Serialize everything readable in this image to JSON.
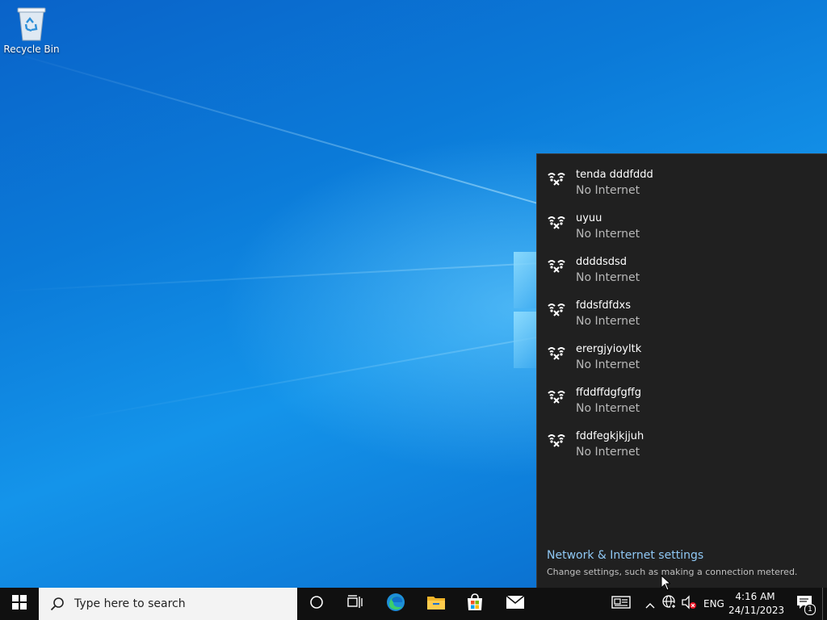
{
  "desktop": {
    "icons": [
      {
        "label": "Recycle Bin",
        "icon": "recycle-bin-icon"
      }
    ]
  },
  "network_flyout": {
    "networks": [
      {
        "name": "tenda dddfddd",
        "status": "No Internet",
        "icon": "wifi-no-internet-icon"
      },
      {
        "name": "uyuu",
        "status": "No Internet",
        "icon": "wifi-no-internet-icon"
      },
      {
        "name": "ddddsdsd",
        "status": "No Internet",
        "icon": "wifi-no-internet-icon"
      },
      {
        "name": "fddsfdfdxs",
        "status": "No Internet",
        "icon": "wifi-no-internet-icon"
      },
      {
        "name": "erergjyioyltk",
        "status": "No Internet",
        "icon": "wifi-no-internet-icon"
      },
      {
        "name": "ffddffdgfgffg",
        "status": "No Internet",
        "icon": "wifi-no-internet-icon"
      },
      {
        "name": "fddfegkjkjjuh",
        "status": "No Internet",
        "icon": "wifi-no-internet-icon"
      }
    ],
    "settings_link": "Network & Internet settings",
    "settings_description": "Change settings, such as making a connection metered."
  },
  "taskbar": {
    "search_placeholder": "Type here to search",
    "pinned": [
      "start-icon",
      "cortana-icon",
      "task-view-icon",
      "edge-icon",
      "file-explorer-icon",
      "store-icon",
      "mail-icon"
    ],
    "tray": {
      "language": "ENG",
      "time": "4:16 AM",
      "date": "24/11/2023",
      "notification_count": "1"
    }
  },
  "colors": {
    "flyout_bg": "#202020",
    "link": "#8fc8f5",
    "taskbar_bg": "#101010",
    "status_text": "#b8b8b8"
  }
}
